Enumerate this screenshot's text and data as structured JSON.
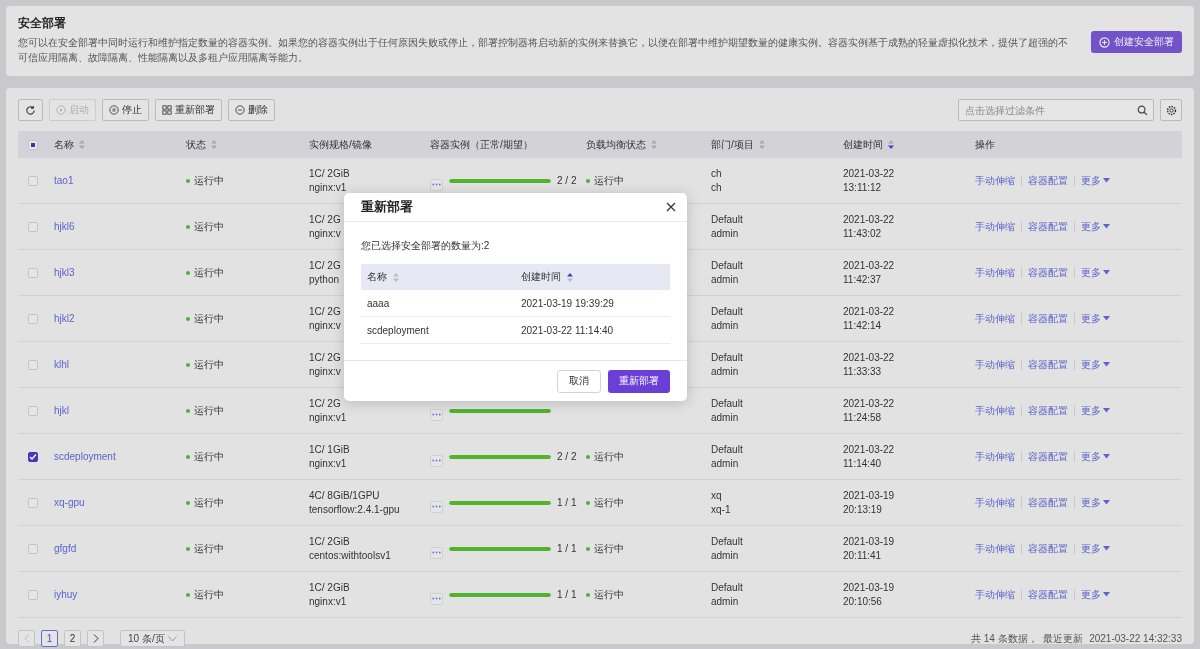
{
  "header": {
    "title": "安全部署",
    "description": "您可以在安全部署中同时运行和维护指定数量的容器实例。如果您的容器实例出于任何原因失败或停止，部署控制器将启动新的实例来替换它，以便在部署中维护期望数量的健康实例。容器实例基于成熟的轻量虚拟化技术，提供了超强的不可信应用隔离、故障隔离、性能隔离以及多租户应用隔离等能力。",
    "create_button": "创建安全部署"
  },
  "toolbar": {
    "buttons": [
      {
        "kind": "refresh",
        "disabled": false
      },
      {
        "kind": "start",
        "label": "启动",
        "disabled": true
      },
      {
        "kind": "stop",
        "label": "停止",
        "disabled": false
      },
      {
        "kind": "redeploy",
        "label": "重新部署",
        "disabled": false
      },
      {
        "kind": "delete",
        "label": "删除",
        "disabled": false
      }
    ],
    "filter": {
      "placeholder": "点击选择过滤条件"
    }
  },
  "table": {
    "select_all": {
      "indeterminate": true
    },
    "columns": [
      {
        "label": "名称",
        "sortable": true,
        "sort_asc": false,
        "sort_desc": false
      },
      {
        "label": "状态",
        "sortable": true,
        "sort_asc": false,
        "sort_desc": false
      },
      {
        "label": "实例规格/镜像"
      },
      {
        "label": "容器实例（正常/期望）"
      },
      {
        "label": "负载均衡状态",
        "sortable": true,
        "sort_asc": false,
        "sort_desc": false
      },
      {
        "label": "部门/项目",
        "sortable": true,
        "sort_asc": false,
        "sort_desc": false
      },
      {
        "label": "创建时间",
        "sortable": true,
        "sort_asc": false,
        "sort_desc": true
      },
      {
        "label": "操作"
      }
    ],
    "rows": [
      {
        "checked": false,
        "name": "tao1",
        "status": "运行中",
        "spec": "1C/ 2GiB",
        "image": "nginx:v1",
        "instances": {
          "level": 1,
          "count": "2 / 2"
        },
        "lb_status": "运行中",
        "dept": "ch",
        "project": "ch",
        "date": "2021-03-22",
        "time": "13:11:12",
        "actions": [
          "手动伸缩",
          "容器配置",
          "更多"
        ]
      },
      {
        "checked": false,
        "name": "hjkl6",
        "status": "运行中",
        "spec": "1C/ 2G",
        "image": "nginx:v",
        "dept": "Default",
        "project": "admin",
        "date": "2021-03-22",
        "time": "11:43:02",
        "actions": [
          "手动伸缩",
          "容器配置",
          "更多"
        ]
      },
      {
        "checked": false,
        "name": "hjkl3",
        "status": "运行中",
        "spec": "1C/ 2G",
        "image": "python",
        "dept": "Default",
        "project": "admin",
        "date": "2021-03-22",
        "time": "11:42:37",
        "actions": [
          "手动伸缩",
          "容器配置",
          "更多"
        ]
      },
      {
        "checked": false,
        "name": "hjkl2",
        "status": "运行中",
        "spec": "1C/ 2G",
        "image": "nginx:v",
        "dept": "Default",
        "project": "admin",
        "date": "2021-03-22",
        "time": "11:42:14",
        "actions": [
          "手动伸缩",
          "容器配置",
          "更多"
        ]
      },
      {
        "checked": false,
        "name": "klhl",
        "status": "运行中",
        "spec": "1C/ 2G",
        "image": "nginx:v",
        "dept": "Default",
        "project": "admin",
        "date": "2021-03-22",
        "time": "11:33:33",
        "actions": [
          "手动伸缩",
          "容器配置",
          "更多"
        ]
      },
      {
        "checked": false,
        "name": "hjkl",
        "status": "运行中",
        "spec": "1C/ 2G",
        "image": "nginx:v1",
        "instances": {
          "level": 1
        },
        "dept": "Default",
        "project": "admin",
        "date": "2021-03-22",
        "time": "11:24:58",
        "actions": [
          "手动伸缩",
          "容器配置",
          "更多"
        ]
      },
      {
        "checked": true,
        "name": "scdeployment",
        "status": "运行中",
        "spec": "1C/ 1GiB",
        "image": "nginx:v1",
        "instances": {
          "level": 1,
          "count": "2 / 2"
        },
        "lb_status": "运行中",
        "dept": "Default",
        "project": "admin",
        "date": "2021-03-22",
        "time": "11:14:40",
        "actions": [
          "手动伸缩",
          "容器配置",
          "更多"
        ]
      },
      {
        "checked": false,
        "name": "xq-gpu",
        "status": "运行中",
        "spec": "4C/ 8GiB/1GPU",
        "image": "tensorflow:2.4.1-gpu",
        "instances": {
          "level": 1,
          "count": "1 / 1"
        },
        "lb_status": "运行中",
        "dept": "xq",
        "project": "xq-1",
        "date": "2021-03-19",
        "time": "20:13:19",
        "actions": [
          "手动伸缩",
          "容器配置",
          "更多"
        ]
      },
      {
        "checked": false,
        "name": "gfgfd",
        "status": "运行中",
        "spec": "1C/ 2GiB",
        "image": "centos:withtoolsv1",
        "instances": {
          "level": 1,
          "count": "1 / 1"
        },
        "lb_status": "运行中",
        "dept": "Default",
        "project": "admin",
        "date": "2021-03-19",
        "time": "20:11:41",
        "actions": [
          "手动伸缩",
          "容器配置",
          "更多"
        ]
      },
      {
        "checked": false,
        "name": "iyhuy",
        "status": "运行中",
        "spec": "1C/ 2GiB",
        "image": "nginx:v1",
        "instances": {
          "level": 1,
          "count": "1 / 1"
        },
        "lb_status": "运行中",
        "dept": "Default",
        "project": "admin",
        "date": "2021-03-19",
        "time": "20:10:56",
        "actions": [
          "手动伸缩",
          "容器配置",
          "更多"
        ]
      }
    ]
  },
  "pagination": {
    "prev_disabled": true,
    "pages": [
      {
        "label": "1",
        "selected": true
      },
      {
        "label": "2",
        "selected": false
      }
    ],
    "page_size": "10 条/页",
    "summary": "共 14 条数据，  最近更新",
    "updated": "2021-03-22 14:32:33"
  },
  "dialog": {
    "title": "重新部署",
    "message": "您已选择安全部署的数量为:2",
    "columns": [
      {
        "label": "名称",
        "sortable": true,
        "sort_asc": false,
        "sort_desc": false
      },
      {
        "label": "创建时间",
        "sortable": true,
        "sort_asc": true,
        "sort_desc": false
      }
    ],
    "rows": [
      {
        "name": "aaaa",
        "created": "2021-03-19 19:39:29"
      },
      {
        "name": "scdeployment",
        "created": "2021-03-22 11:14:40"
      }
    ],
    "cancel": "取消",
    "confirm": "重新部署"
  }
}
